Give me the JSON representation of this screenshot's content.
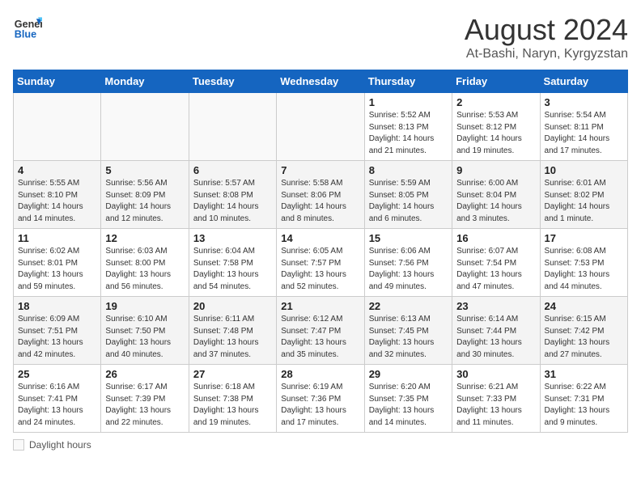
{
  "header": {
    "logo_line1": "General",
    "logo_line2": "Blue",
    "month_title": "August 2024",
    "location": "At-Bashi, Naryn, Kyrgyzstan"
  },
  "weekdays": [
    "Sunday",
    "Monday",
    "Tuesday",
    "Wednesday",
    "Thursday",
    "Friday",
    "Saturday"
  ],
  "weeks": [
    [
      {
        "day": "",
        "info": ""
      },
      {
        "day": "",
        "info": ""
      },
      {
        "day": "",
        "info": ""
      },
      {
        "day": "",
        "info": ""
      },
      {
        "day": "1",
        "info": "Sunrise: 5:52 AM\nSunset: 8:13 PM\nDaylight: 14 hours\nand 21 minutes."
      },
      {
        "day": "2",
        "info": "Sunrise: 5:53 AM\nSunset: 8:12 PM\nDaylight: 14 hours\nand 19 minutes."
      },
      {
        "day": "3",
        "info": "Sunrise: 5:54 AM\nSunset: 8:11 PM\nDaylight: 14 hours\nand 17 minutes."
      }
    ],
    [
      {
        "day": "4",
        "info": "Sunrise: 5:55 AM\nSunset: 8:10 PM\nDaylight: 14 hours\nand 14 minutes."
      },
      {
        "day": "5",
        "info": "Sunrise: 5:56 AM\nSunset: 8:09 PM\nDaylight: 14 hours\nand 12 minutes."
      },
      {
        "day": "6",
        "info": "Sunrise: 5:57 AM\nSunset: 8:08 PM\nDaylight: 14 hours\nand 10 minutes."
      },
      {
        "day": "7",
        "info": "Sunrise: 5:58 AM\nSunset: 8:06 PM\nDaylight: 14 hours\nand 8 minutes."
      },
      {
        "day": "8",
        "info": "Sunrise: 5:59 AM\nSunset: 8:05 PM\nDaylight: 14 hours\nand 6 minutes."
      },
      {
        "day": "9",
        "info": "Sunrise: 6:00 AM\nSunset: 8:04 PM\nDaylight: 14 hours\nand 3 minutes."
      },
      {
        "day": "10",
        "info": "Sunrise: 6:01 AM\nSunset: 8:02 PM\nDaylight: 14 hours\nand 1 minute."
      }
    ],
    [
      {
        "day": "11",
        "info": "Sunrise: 6:02 AM\nSunset: 8:01 PM\nDaylight: 13 hours\nand 59 minutes."
      },
      {
        "day": "12",
        "info": "Sunrise: 6:03 AM\nSunset: 8:00 PM\nDaylight: 13 hours\nand 56 minutes."
      },
      {
        "day": "13",
        "info": "Sunrise: 6:04 AM\nSunset: 7:58 PM\nDaylight: 13 hours\nand 54 minutes."
      },
      {
        "day": "14",
        "info": "Sunrise: 6:05 AM\nSunset: 7:57 PM\nDaylight: 13 hours\nand 52 minutes."
      },
      {
        "day": "15",
        "info": "Sunrise: 6:06 AM\nSunset: 7:56 PM\nDaylight: 13 hours\nand 49 minutes."
      },
      {
        "day": "16",
        "info": "Sunrise: 6:07 AM\nSunset: 7:54 PM\nDaylight: 13 hours\nand 47 minutes."
      },
      {
        "day": "17",
        "info": "Sunrise: 6:08 AM\nSunset: 7:53 PM\nDaylight: 13 hours\nand 44 minutes."
      }
    ],
    [
      {
        "day": "18",
        "info": "Sunrise: 6:09 AM\nSunset: 7:51 PM\nDaylight: 13 hours\nand 42 minutes."
      },
      {
        "day": "19",
        "info": "Sunrise: 6:10 AM\nSunset: 7:50 PM\nDaylight: 13 hours\nand 40 minutes."
      },
      {
        "day": "20",
        "info": "Sunrise: 6:11 AM\nSunset: 7:48 PM\nDaylight: 13 hours\nand 37 minutes."
      },
      {
        "day": "21",
        "info": "Sunrise: 6:12 AM\nSunset: 7:47 PM\nDaylight: 13 hours\nand 35 minutes."
      },
      {
        "day": "22",
        "info": "Sunrise: 6:13 AM\nSunset: 7:45 PM\nDaylight: 13 hours\nand 32 minutes."
      },
      {
        "day": "23",
        "info": "Sunrise: 6:14 AM\nSunset: 7:44 PM\nDaylight: 13 hours\nand 30 minutes."
      },
      {
        "day": "24",
        "info": "Sunrise: 6:15 AM\nSunset: 7:42 PM\nDaylight: 13 hours\nand 27 minutes."
      }
    ],
    [
      {
        "day": "25",
        "info": "Sunrise: 6:16 AM\nSunset: 7:41 PM\nDaylight: 13 hours\nand 24 minutes."
      },
      {
        "day": "26",
        "info": "Sunrise: 6:17 AM\nSunset: 7:39 PM\nDaylight: 13 hours\nand 22 minutes."
      },
      {
        "day": "27",
        "info": "Sunrise: 6:18 AM\nSunset: 7:38 PM\nDaylight: 13 hours\nand 19 minutes."
      },
      {
        "day": "28",
        "info": "Sunrise: 6:19 AM\nSunset: 7:36 PM\nDaylight: 13 hours\nand 17 minutes."
      },
      {
        "day": "29",
        "info": "Sunrise: 6:20 AM\nSunset: 7:35 PM\nDaylight: 13 hours\nand 14 minutes."
      },
      {
        "day": "30",
        "info": "Sunrise: 6:21 AM\nSunset: 7:33 PM\nDaylight: 13 hours\nand 11 minutes."
      },
      {
        "day": "31",
        "info": "Sunrise: 6:22 AM\nSunset: 7:31 PM\nDaylight: 13 hours\nand 9 minutes."
      }
    ]
  ],
  "legend": {
    "label": "Daylight hours"
  }
}
